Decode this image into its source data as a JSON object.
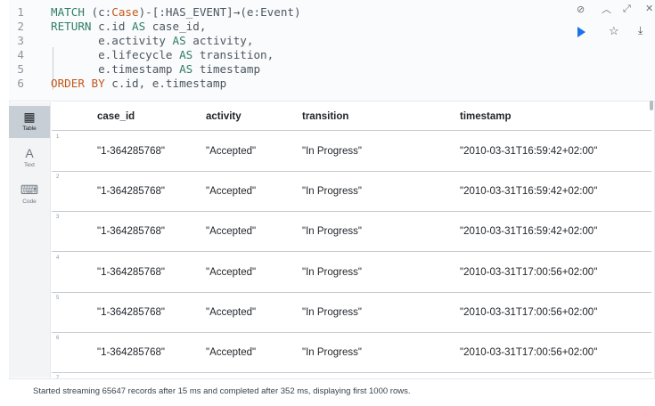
{
  "query": {
    "lines": [
      {
        "n": "1",
        "parts": [
          {
            "t": "MATCH ",
            "c": "kw"
          },
          {
            "t": "(c:",
            "c": ""
          },
          {
            "t": "Case",
            "c": "lbl"
          },
          {
            "t": ")-[:HAS_EVENT]→(e:Event)",
            "c": ""
          }
        ]
      },
      {
        "n": "2",
        "parts": [
          {
            "t": "RETURN ",
            "c": "kw"
          },
          {
            "t": "c.id ",
            "c": ""
          },
          {
            "t": "AS ",
            "c": "kw"
          },
          {
            "t": "case_id,",
            "c": ""
          }
        ]
      },
      {
        "n": "3",
        "parts": [
          {
            "t": "       e.activity ",
            "c": ""
          },
          {
            "t": "AS ",
            "c": "kw"
          },
          {
            "t": "activity,",
            "c": ""
          }
        ]
      },
      {
        "n": "4",
        "parts": [
          {
            "t": "       e.lifecycle ",
            "c": ""
          },
          {
            "t": "AS ",
            "c": "kw"
          },
          {
            "t": "transition,",
            "c": ""
          }
        ]
      },
      {
        "n": "5",
        "parts": [
          {
            "t": "       e.timestamp ",
            "c": ""
          },
          {
            "t": "AS ",
            "c": "kw"
          },
          {
            "t": "timestamp",
            "c": ""
          }
        ]
      },
      {
        "n": "6",
        "parts": [
          {
            "t": "ORDER BY ",
            "c": "lbl"
          },
          {
            "t": "c.id, e.timestamp",
            "c": ""
          }
        ]
      }
    ]
  },
  "toolbar": {
    "pin_icon": "pin-icon",
    "collapse_icon": "chevron-up-icon",
    "expand_icon": "expand-icon",
    "close_icon": "close-icon",
    "run_icon": "play-icon",
    "favorite_icon": "star-icon",
    "download_icon": "download-icon",
    "run_color": "#1a73e8"
  },
  "views": [
    {
      "label": "Table",
      "glyph": "▦",
      "icon": "table-icon",
      "active": true
    },
    {
      "label": "Text",
      "glyph": "A",
      "icon": "text-icon",
      "active": false
    },
    {
      "label": "Code",
      "glyph": "⌨",
      "icon": "code-icon",
      "active": false
    }
  ],
  "table": {
    "columns": [
      "case_id",
      "activity",
      "transition",
      "timestamp"
    ],
    "rows": [
      {
        "n": "1",
        "cells": [
          "\"1-364285768\"",
          "\"Accepted\"",
          "\"In Progress\"",
          "\"2010-03-31T16:59:42+02:00\""
        ]
      },
      {
        "n": "2",
        "cells": [
          "\"1-364285768\"",
          "\"Accepted\"",
          "\"In Progress\"",
          "\"2010-03-31T16:59:42+02:00\""
        ]
      },
      {
        "n": "3",
        "cells": [
          "\"1-364285768\"",
          "\"Accepted\"",
          "\"In Progress\"",
          "\"2010-03-31T16:59:42+02:00\""
        ]
      },
      {
        "n": "4",
        "cells": [
          "\"1-364285768\"",
          "\"Accepted\"",
          "\"In Progress\"",
          "\"2010-03-31T17:00:56+02:00\""
        ]
      },
      {
        "n": "5",
        "cells": [
          "\"1-364285768\"",
          "\"Accepted\"",
          "\"In Progress\"",
          "\"2010-03-31T17:00:56+02:00\""
        ]
      },
      {
        "n": "6",
        "cells": [
          "\"1-364285768\"",
          "\"Accepted\"",
          "\"In Progress\"",
          "\"2010-03-31T17:00:56+02:00\""
        ]
      },
      {
        "n": "7",
        "cells": []
      }
    ]
  },
  "status": "Started streaming 65647 records after 15 ms and completed after 352 ms, displaying first 1000 rows."
}
